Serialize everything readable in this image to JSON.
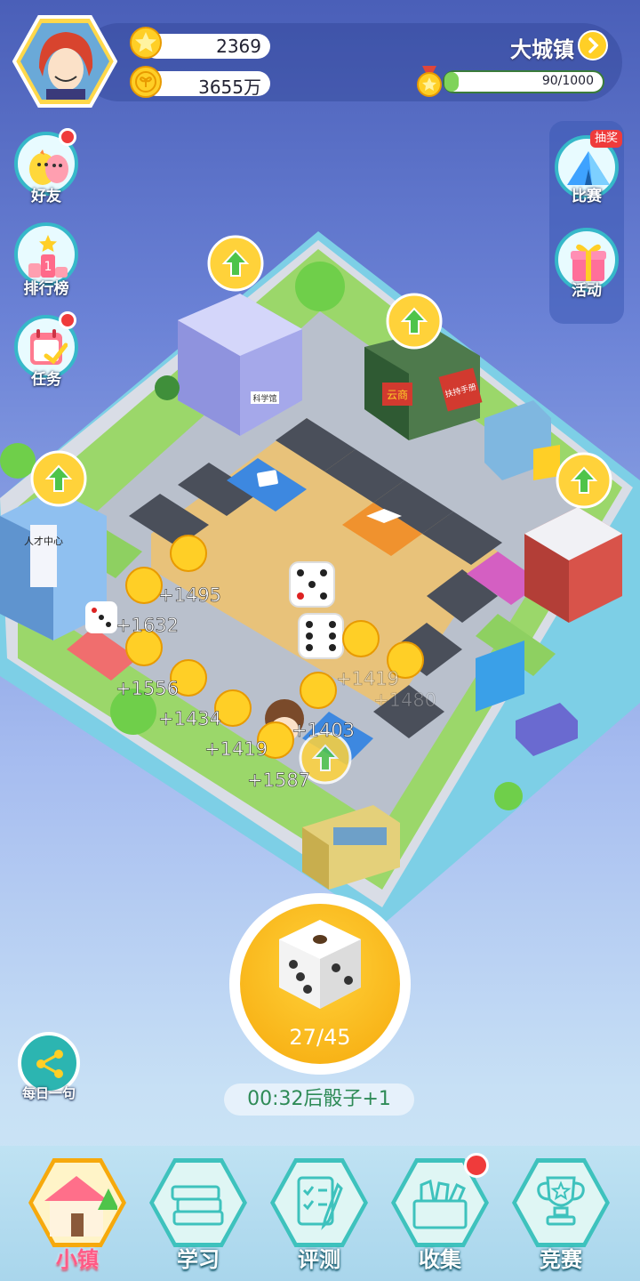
{
  "header": {
    "stars": "2369",
    "coins": "3655万",
    "town_name": "大城镇",
    "xp": "90/1000"
  },
  "left_menu": [
    {
      "label": "好友",
      "icon": "chick-icon",
      "badge": true
    },
    {
      "label": "排行榜",
      "icon": "podium-icon",
      "badge": false
    },
    {
      "label": "任务",
      "icon": "calendar-check-icon",
      "badge": true
    }
  ],
  "right_menu": [
    {
      "label": "比赛",
      "tag": "抽奖",
      "icon": "tent-icon"
    },
    {
      "label": "活动",
      "icon": "gift-icon"
    }
  ],
  "board": {
    "signs": [
      "人才中心",
      "云商",
      "扶持手册",
      "科学馆"
    ],
    "coin_gains": [
      "+1495",
      "+1632",
      "+1556",
      "+1434",
      "+1419",
      "+1587",
      "+1403",
      "+1419",
      "+1480"
    ]
  },
  "roll": {
    "count": "27/45",
    "timer": "00:32后骰子+1"
  },
  "share": {
    "label": "每日一句"
  },
  "bottom_nav": [
    {
      "label": "小镇",
      "icon": "house-icon",
      "active": true,
      "badge": false
    },
    {
      "label": "学习",
      "icon": "books-icon",
      "active": false,
      "badge": false
    },
    {
      "label": "评测",
      "icon": "checklist-icon",
      "active": false,
      "badge": false
    },
    {
      "label": "收集",
      "icon": "box-icon",
      "active": false,
      "badge": true
    },
    {
      "label": "竞赛",
      "icon": "trophy-icon",
      "active": false,
      "badge": false
    }
  ],
  "colors": {
    "accent_yellow": "#f6a90c",
    "teal": "#3ec2bd",
    "badge_red": "#ef3b3b",
    "board_sand": "#e8c27a",
    "tile_dark": "#4a4f5a",
    "tile_blue": "#3d88e0",
    "tile_orange": "#f0922e"
  }
}
